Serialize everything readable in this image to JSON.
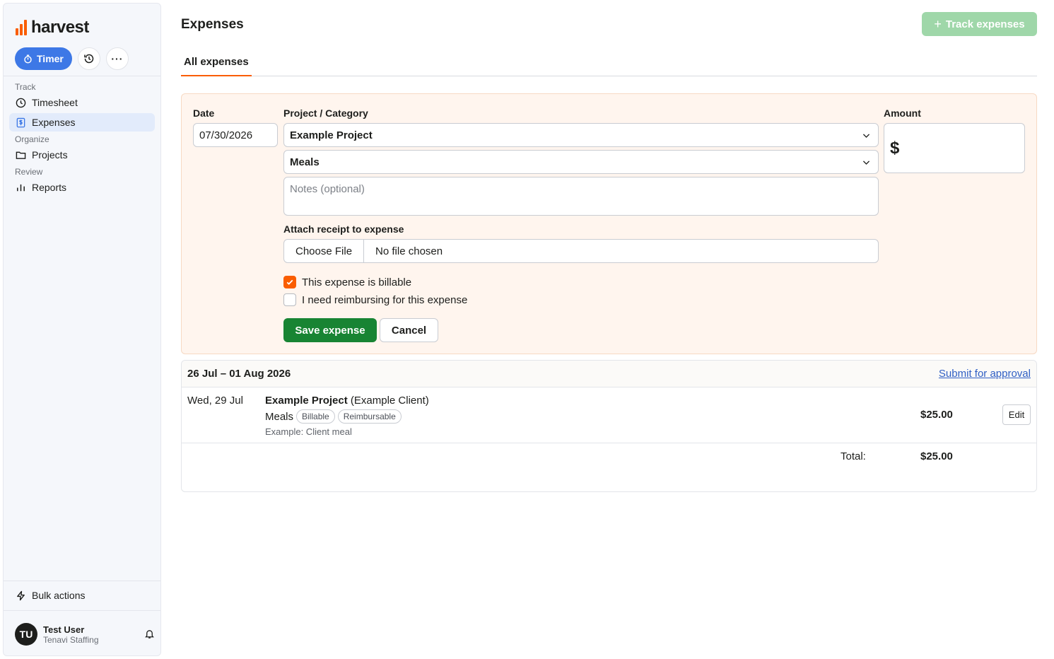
{
  "app": {
    "logo_text": "harvest",
    "timer_label": "Timer"
  },
  "sidebar": {
    "groups": {
      "track": "Track",
      "organize": "Organize",
      "review": "Review"
    },
    "items": [
      {
        "label": "Timesheet",
        "icon": "clock-icon"
      },
      {
        "label": "Expenses",
        "icon": "dollar-receipt-icon",
        "active": true
      },
      {
        "label": "Projects",
        "icon": "folder-icon"
      },
      {
        "label": "Reports",
        "icon": "bar-chart-icon"
      }
    ],
    "bulk_actions": "Bulk actions",
    "user": {
      "initials": "TU",
      "name": "Test User",
      "org": "Tenavi Staffing"
    }
  },
  "header": {
    "title": "Expenses",
    "track_button": "Track expenses",
    "tab": "All expenses"
  },
  "form": {
    "date_label": "Date",
    "date_value": "07/30/2026",
    "project_label": "Project / Category",
    "project_value": "Example Project",
    "category_value": "Meals",
    "notes_placeholder": "Notes (optional)",
    "amount_label": "Amount",
    "amount_symbol": "$",
    "receipt_label": "Attach receipt to expense",
    "choose_file": "Choose File",
    "file_status": "No file chosen",
    "billable_label": "This expense is billable",
    "billable_checked": true,
    "reimburse_label": "I need reimbursing for this expense",
    "reimburse_checked": false,
    "save_button": "Save expense",
    "cancel_button": "Cancel"
  },
  "week": {
    "range": "26 Jul – 01 Aug 2026",
    "submit_link": "Submit for approval",
    "entries": [
      {
        "date": "Wed, 29 Jul",
        "project": "Example Project",
        "client": "(Example Client)",
        "category": "Meals",
        "tags": [
          "Billable",
          "Reimbursable"
        ],
        "note": "Example: Client meal",
        "amount": "$25.00",
        "edit_label": "Edit"
      }
    ],
    "total_label": "Total:",
    "total_amount": "$25.00"
  },
  "colors": {
    "brand_orange": "#fa5d00",
    "timer_blue": "#3d78e6",
    "save_green": "#188433",
    "track_green_disabled": "#9fd7a9",
    "form_bg": "#fff5ee"
  }
}
